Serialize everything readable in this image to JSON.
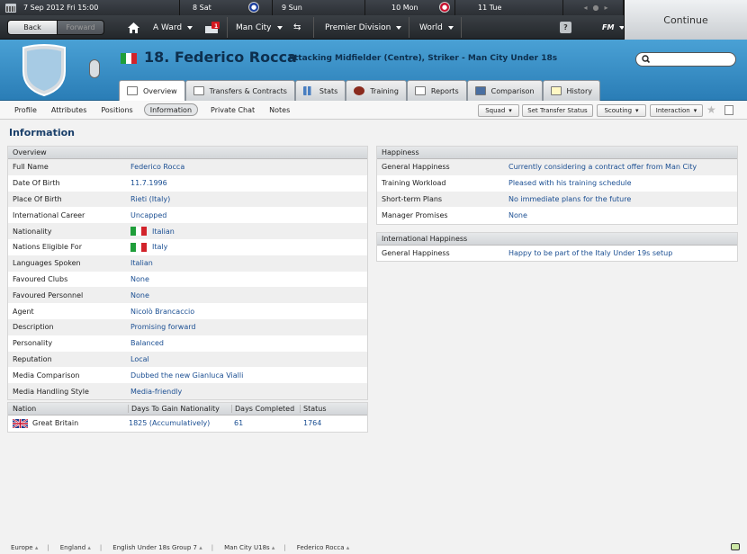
{
  "calendar": {
    "current": "7 Sep 2012 Fri 15:00",
    "days": [
      {
        "label": "8 Sat",
        "badge": "chelsea"
      },
      {
        "label": "9 Sun",
        "badge": ""
      },
      {
        "label": "10 Mon",
        "badge": "sheffield"
      },
      {
        "label": "11 Tue",
        "badge": ""
      }
    ]
  },
  "nav": {
    "back": "Back",
    "forward": "Forward",
    "manager": "A Ward",
    "inbox_count": "1",
    "club": "Man City",
    "competition": "Premier Division",
    "world": "World",
    "help": "?",
    "fm_menu": "FM",
    "continue": "Continue"
  },
  "player": {
    "number_name": "18. Federico Rocca",
    "subtitle": "Attacking Midfielder (Centre), Striker - Man City Under 18s",
    "flag_colors": [
      "#1f9e3a",
      "#ffffff",
      "#d2232a"
    ]
  },
  "search": {
    "placeholder": ""
  },
  "tabs": [
    {
      "label": "Overview",
      "active": true
    },
    {
      "label": "Transfers & Contracts",
      "active": false
    },
    {
      "label": "Stats",
      "active": false
    },
    {
      "label": "Training",
      "active": false
    },
    {
      "label": "Reports",
      "active": false
    },
    {
      "label": "Comparison",
      "active": false
    },
    {
      "label": "History",
      "active": false
    }
  ],
  "subnav": {
    "items": [
      "Profile",
      "Attributes",
      "Positions",
      "Information",
      "Private Chat",
      "Notes"
    ],
    "active": "Information",
    "squad": "Squad",
    "transfer_status": "Set Transfer Status",
    "scouting": "Scouting",
    "interaction": "Interaction"
  },
  "page_heading": "Information",
  "overview": {
    "title": "Overview",
    "rows": [
      {
        "label": "Full Name",
        "value": "Federico Rocca"
      },
      {
        "label": "Date Of Birth",
        "value": "11.7.1996"
      },
      {
        "label": "Place Of Birth",
        "value": "Rieti (Italy)"
      },
      {
        "label": "International Career",
        "value": "Uncapped"
      },
      {
        "label": "Nationality",
        "value": "Italian"
      },
      {
        "label": "Nations Eligible For",
        "value": "Italy"
      },
      {
        "label": "Languages Spoken",
        "value": "Italian"
      },
      {
        "label": "Favoured Clubs",
        "value": "None"
      },
      {
        "label": "Favoured Personnel",
        "value": "None"
      },
      {
        "label": "Agent",
        "value": "Nicolò Brancaccio"
      },
      {
        "label": "Description",
        "value": "Promising forward"
      },
      {
        "label": "Personality",
        "value": "Balanced"
      },
      {
        "label": "Reputation",
        "value": "Local"
      },
      {
        "label": "Media Comparison",
        "value": "Dubbed the new Gianluca Vialli"
      },
      {
        "label": "Media Handling Style",
        "value": "Media-friendly"
      }
    ]
  },
  "nationality_table": {
    "headers": [
      "Nation",
      "Days To Gain Nationality",
      "Days Completed",
      "Status"
    ],
    "rows": [
      {
        "nation": "Great Britain",
        "days_to_gain": "1825 (Accumulatively)",
        "days_completed": "61",
        "status": "1764"
      }
    ]
  },
  "happiness": {
    "title": "Happiness",
    "rows": [
      {
        "label": "General Happiness",
        "value": "Currently considering a contract offer from Man City"
      },
      {
        "label": "Training Workload",
        "value": "Pleased with his training schedule"
      },
      {
        "label": "Short-term Plans",
        "value": "No immediate plans for the future"
      },
      {
        "label": "Manager Promises",
        "value": "None"
      }
    ]
  },
  "international_happiness": {
    "title": "International Happiness",
    "rows": [
      {
        "label": "General Happiness",
        "value": "Happy to be part of the Italy Under 19s setup"
      }
    ]
  },
  "breadcrumbs": [
    "Europe",
    "England",
    "English Under 18s Group 7",
    "Man City U18s",
    "Federico Rocca"
  ]
}
